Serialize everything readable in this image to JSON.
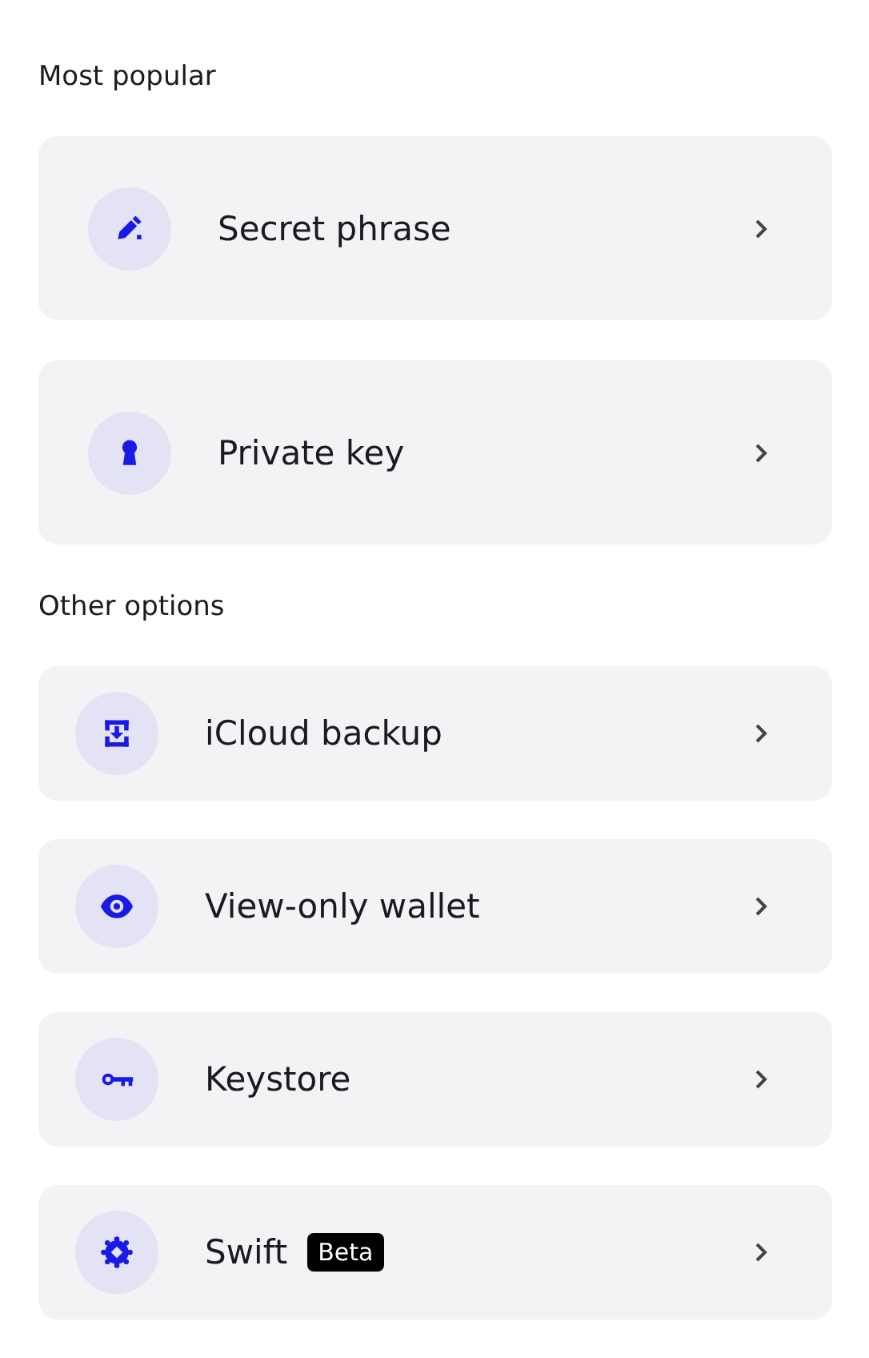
{
  "sections": [
    {
      "title": "Most popular",
      "kind": "large",
      "items": [
        {
          "label": "Secret phrase",
          "kind": "pen"
        },
        {
          "label": "Private key",
          "kind": "keyhole"
        }
      ]
    },
    {
      "title": "Other options",
      "kind": "compact",
      "items": [
        {
          "label": "iCloud backup",
          "kind": "download"
        },
        {
          "label": "View-only wallet",
          "kind": "eye"
        },
        {
          "label": "Keystore",
          "kind": "key"
        },
        {
          "label": "Swift",
          "kind": "gear",
          "badge": "Beta"
        }
      ]
    }
  ]
}
